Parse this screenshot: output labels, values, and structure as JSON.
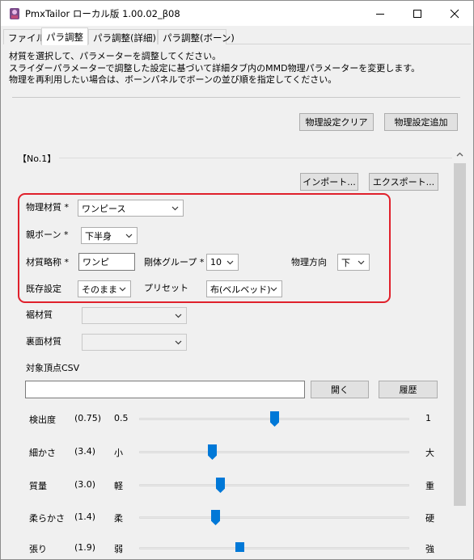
{
  "window": {
    "title": "PmxTailor ローカル版 1.00.02_β08",
    "minimize_icon": "minimize-icon",
    "maximize_icon": "maximize-icon",
    "close_icon": "close-icon"
  },
  "tabs": [
    {
      "label": "ファイル",
      "active": false
    },
    {
      "label": "パラ調整",
      "active": true
    },
    {
      "label": "パラ調整(詳細)",
      "active": false
    },
    {
      "label": "パラ調整(ボーン)",
      "active": false
    }
  ],
  "description": [
    "材質を選択して、パラメーターを調整してください。",
    "スライダーパラメーターで調整した設定に基づいて詳細タブ内のMMD物理パラメーターを変更します。",
    "物理を再利用したい場合は、ボーンパネルでボーンの並び順を指定してください。"
  ],
  "top_buttons": {
    "clear": "物理設定クリア",
    "add": "物理設定追加"
  },
  "group": {
    "title": "【No.1】",
    "import_button": "インポート...",
    "export_button": "エクスポート...",
    "material_label": "物理材質 *",
    "material_value": "ワンピース",
    "parent_bone_label": "親ボーン *",
    "parent_bone_value": "下半身",
    "abbr_label": "材質略称 *",
    "abbr_value": "ワンピ",
    "rigid_group_label": "剛体グループ *",
    "rigid_group_value": "10",
    "direction_label": "物理方向",
    "direction_value": "下",
    "existing_label": "既存設定",
    "existing_value": "そのまま",
    "preset_label": "プリセット",
    "preset_value": "布(ベルベッド)",
    "hem_label": "裾材質",
    "back_label": "裏面材質",
    "csv_label": "対象頂点CSV",
    "csv_value": "",
    "open_button": "開く",
    "history_button": "履歴"
  },
  "sliders": [
    {
      "label": "検出度",
      "value": "(0.75)",
      "min": "0.5",
      "max": "1",
      "fraction": 0.5
    },
    {
      "label": "細かさ",
      "value": "(3.4)",
      "min": "小",
      "max": "大",
      "fraction": 0.27
    },
    {
      "label": "質量",
      "value": "(3.0)",
      "min": "軽",
      "max": "重",
      "fraction": 0.3
    },
    {
      "label": "柔らかさ",
      "value": "(1.4)",
      "min": "柔",
      "max": "硬",
      "fraction": 0.28
    },
    {
      "label": "張り",
      "value": "(1.9)",
      "min": "弱",
      "max": "強",
      "fraction": 0.37
    }
  ],
  "colors": {
    "accent": "#0078d7",
    "highlight": "#e0202b"
  }
}
